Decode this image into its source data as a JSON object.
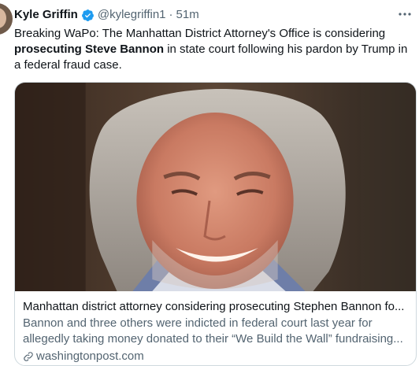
{
  "author": {
    "name": "Kyle Griffin",
    "handle": "@kylegriffin1",
    "separator": "·",
    "time": "51m",
    "verified": true
  },
  "tweet": {
    "text_part1": "Breaking WaPo: The Manhattan District Attorney's Office is considering ",
    "text_bold": "prosecuting Steve Bannon",
    "text_part2": " in state court following his pardon by Trump in a federal fraud case."
  },
  "more_icon": "more-horizontal-icon",
  "card": {
    "title": "Manhattan district attorney considering prosecuting Stephen Bannon fo...",
    "description": "Bannon and three others were indicted in federal court last year for allegedly taking money donated to their “We Build the Wall” fundraising...",
    "domain": "washingtonpost.com",
    "domain_icon": "link-icon"
  },
  "colors": {
    "text_primary": "#0f1419",
    "text_secondary": "#536471",
    "verified_blue": "#1d9bf0",
    "border": "#cfd9de"
  }
}
